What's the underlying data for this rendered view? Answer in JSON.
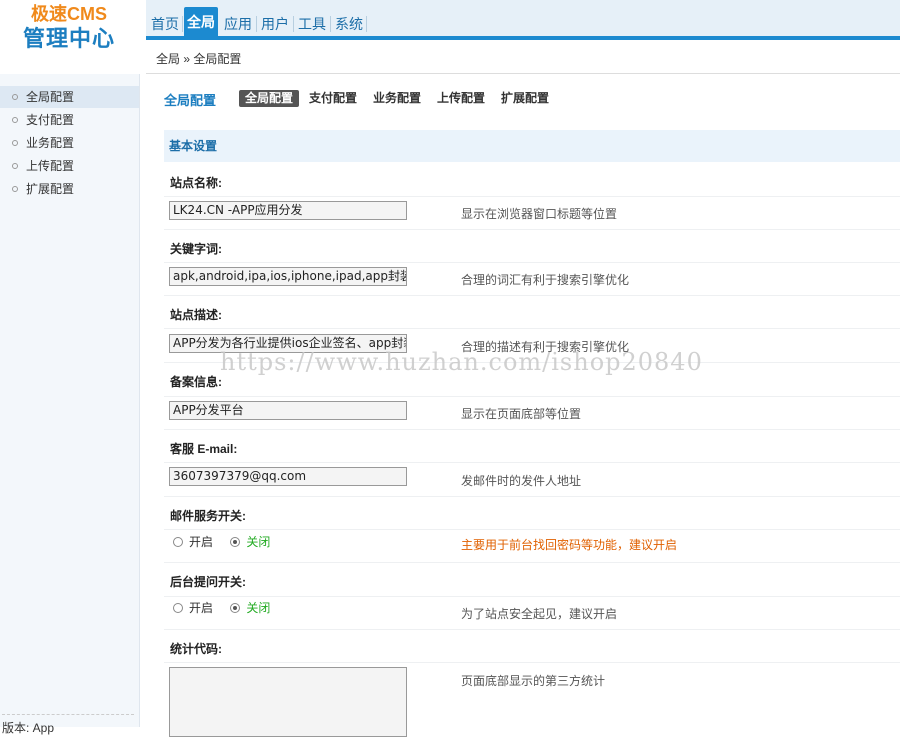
{
  "logo": {
    "top": "极速CMS",
    "bottom": "管理中心"
  },
  "nav": [
    "首页",
    "全局",
    "应用",
    "用户",
    "工具",
    "系统"
  ],
  "nav_active_index": 1,
  "breadcrumb": "全局 » 全局配置",
  "sidebar": {
    "items": [
      "全局配置",
      "支付配置",
      "业务配置",
      "上传配置",
      "扩展配置"
    ],
    "active_index": 0,
    "version": "版本: App"
  },
  "main": {
    "title": "全局配置",
    "tabs": [
      "全局配置",
      "支付配置",
      "业务配置",
      "上传配置",
      "扩展配置"
    ],
    "active_tab": 0,
    "section": "基本设置",
    "fields": {
      "site_name": {
        "label": "站点名称:",
        "value": "LK24.CN -APP应用分发",
        "hint": "显示在浏览器窗口标题等位置"
      },
      "keywords": {
        "label": "关键字词:",
        "value": "apk,android,ipa,ios,iphone,ipad,app封装",
        "hint": "合理的词汇有利于搜索引擎优化"
      },
      "description": {
        "label": "站点描述:",
        "value": "APP分发为各行业提供ios企业签名、app封装",
        "hint": "合理的描述有利于搜索引擎优化"
      },
      "icp": {
        "label": "备案信息:",
        "value": "APP分发平台",
        "hint": "显示在页面底部等位置"
      },
      "email": {
        "label": "客服 E-mail:",
        "value": "3607397379@qq.com",
        "hint": "发邮件时的发件人地址"
      },
      "mail_switch": {
        "label": "邮件服务开关:",
        "on": "开启",
        "off": "关闭",
        "selected": "off",
        "hint": "主要用于前台找回密码等功能，建议开启"
      },
      "question_switch": {
        "label": "后台提问开关:",
        "on": "开启",
        "off": "关闭",
        "selected": "off",
        "hint": "为了站点安全起见，建议开启"
      },
      "stats": {
        "label": "统计代码:",
        "value": "",
        "hint": "页面底部显示的第三方统计"
      }
    }
  },
  "watermark": "https://www.huzhan.com/ishop20840",
  "colors": {
    "accent": "#1c8ad0",
    "logo_orange": "#f08a1c",
    "warn": "#e06000",
    "green": "#22aa22"
  }
}
